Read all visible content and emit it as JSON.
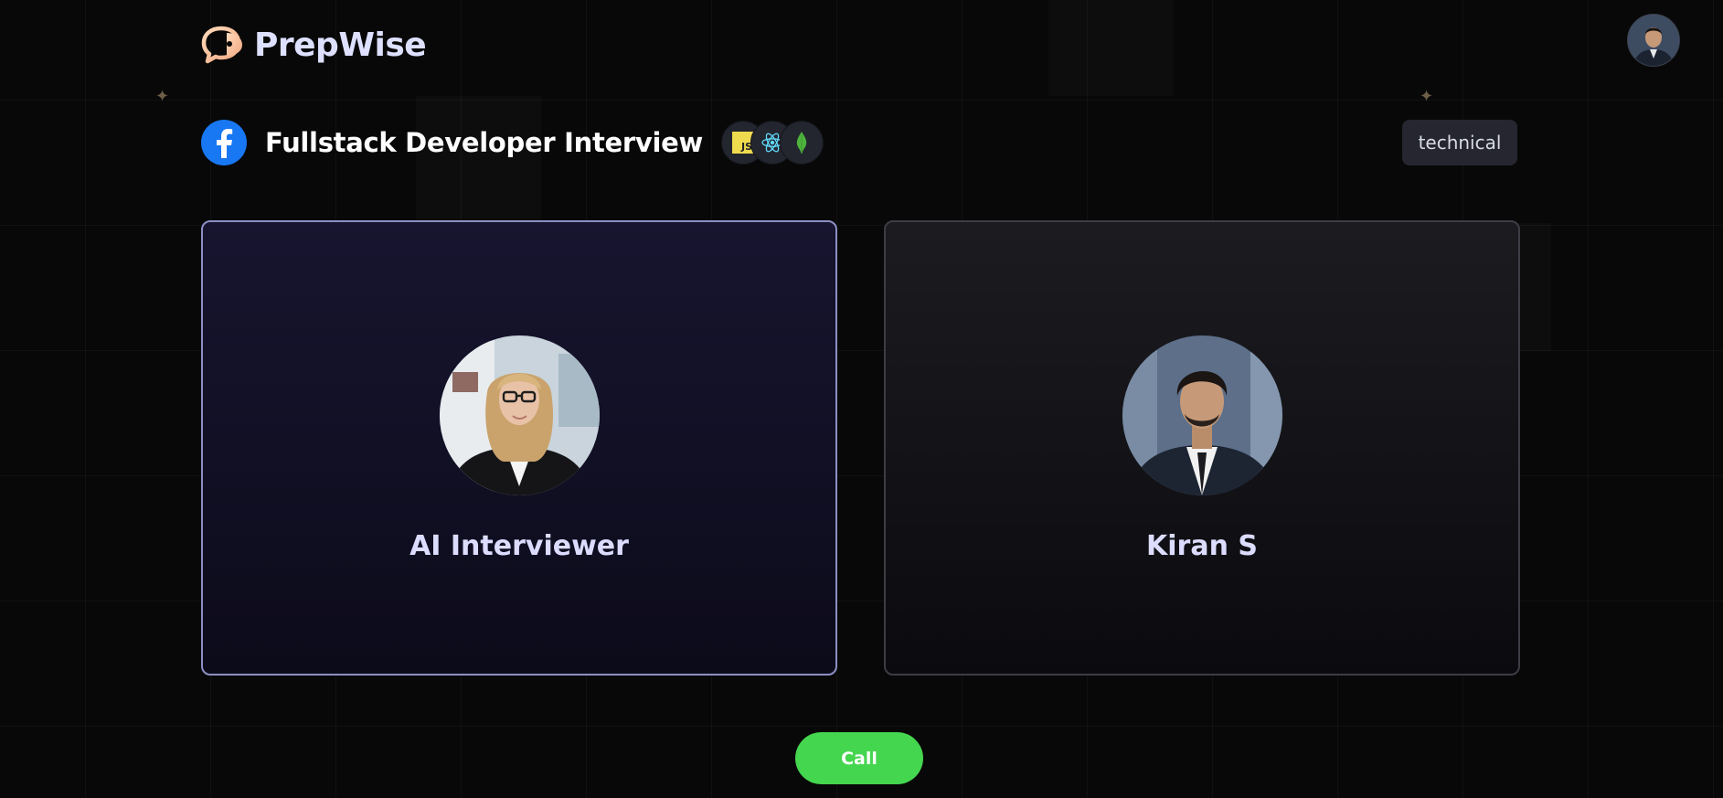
{
  "app": {
    "name": "PrepWise",
    "logo_icon": "chat-bubble-icon"
  },
  "user_avatar": {
    "icon": "user-avatar"
  },
  "interview": {
    "title": "Fullstack Developer Interview",
    "company_icon": "facebook-icon",
    "tech_stack": [
      {
        "name": "JavaScript",
        "icon": "javascript-icon",
        "label": "JS"
      },
      {
        "name": "React",
        "icon": "react-icon"
      },
      {
        "name": "MongoDB",
        "icon": "mongodb-icon"
      }
    ],
    "type": "technical"
  },
  "participants": {
    "ai": {
      "name": "AI Interviewer"
    },
    "user": {
      "name": "Kiran S"
    }
  },
  "actions": {
    "call_label": "Call"
  },
  "colors": {
    "accent": "#45d64f",
    "brand_text": "#dde0ff",
    "facebook": "#1877f2",
    "ai_card_border": "#8d8fc4"
  }
}
